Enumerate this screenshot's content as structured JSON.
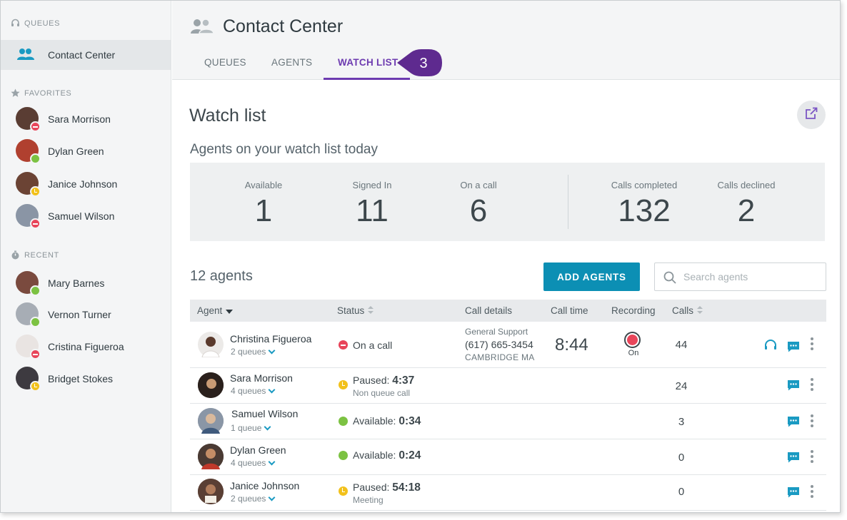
{
  "sidebar": {
    "queues_heading": "QUEUES",
    "active_item": "Contact Center",
    "favorites_heading": "FAVORITES",
    "favorites": [
      {
        "name": "Sara Morrison",
        "status": "busy"
      },
      {
        "name": "Dylan Green",
        "status": "available"
      },
      {
        "name": "Janice Johnson",
        "status": "paused"
      },
      {
        "name": "Samuel Wilson",
        "status": "busy"
      }
    ],
    "recent_heading": "RECENT",
    "recent": [
      {
        "name": "Mary Barnes",
        "status": "available"
      },
      {
        "name": "Vernon Turner",
        "status": "available"
      },
      {
        "name": "Cristina Figueroa",
        "status": "busy"
      },
      {
        "name": "Bridget Stokes",
        "status": "paused"
      }
    ]
  },
  "header": {
    "title": "Contact Center",
    "tabs": [
      "QUEUES",
      "AGENTS",
      "WATCH LIST"
    ],
    "active_tab": "WATCH LIST",
    "callout_number": "3"
  },
  "main": {
    "heading": "Watch list",
    "subtitle": "Agents on your watch list today",
    "stats": [
      {
        "label": "Available",
        "value": "1"
      },
      {
        "label": "Signed In",
        "value": "11"
      },
      {
        "label": "On a call",
        "value": "6"
      },
      {
        "label": "Calls completed",
        "value": "132"
      },
      {
        "label": "Calls declined",
        "value": "2"
      }
    ],
    "agent_count": "12 agents",
    "add_button": "ADD AGENTS",
    "search_placeholder": "Search agents",
    "columns": [
      "Agent",
      "Status",
      "Call details",
      "Call time",
      "Recording",
      "Calls"
    ],
    "rows": [
      {
        "name": "Christina Figueroa",
        "queues": "2 queues",
        "status_text": "On a call",
        "status": "busy",
        "call_queue": "General Support",
        "call_number": "(617) 665-3454",
        "call_location": "CAMBRIDGE MA",
        "call_time": "8:44",
        "recording": "On",
        "calls": "44"
      },
      {
        "name": "Sara Morrison",
        "queues": "4 queues",
        "status_label": "Paused:",
        "status_time": "4:37",
        "status_sub": "Non queue call",
        "status": "paused",
        "calls": "24"
      },
      {
        "name": "Samuel Wilson",
        "queues": "1 queue",
        "status_label": "Available:",
        "status_time": "0:34",
        "status": "available",
        "calls": "3"
      },
      {
        "name": "Dylan Green",
        "queues": "4 queues",
        "status_label": "Available:",
        "status_time": "0:24",
        "status": "available",
        "calls": "0"
      },
      {
        "name": "Janice Johnson",
        "queues": "2 queues",
        "status_label": "Paused:",
        "status_time": "54:18",
        "status_sub": "Meeting",
        "status": "paused",
        "calls": "0"
      }
    ]
  },
  "colors": {
    "accent_purple": "#6d3bb0",
    "accent_teal": "#0c8fb4",
    "status_busy": "#e8455a",
    "status_available": "#7cc242",
    "status_paused": "#f2c11b"
  }
}
